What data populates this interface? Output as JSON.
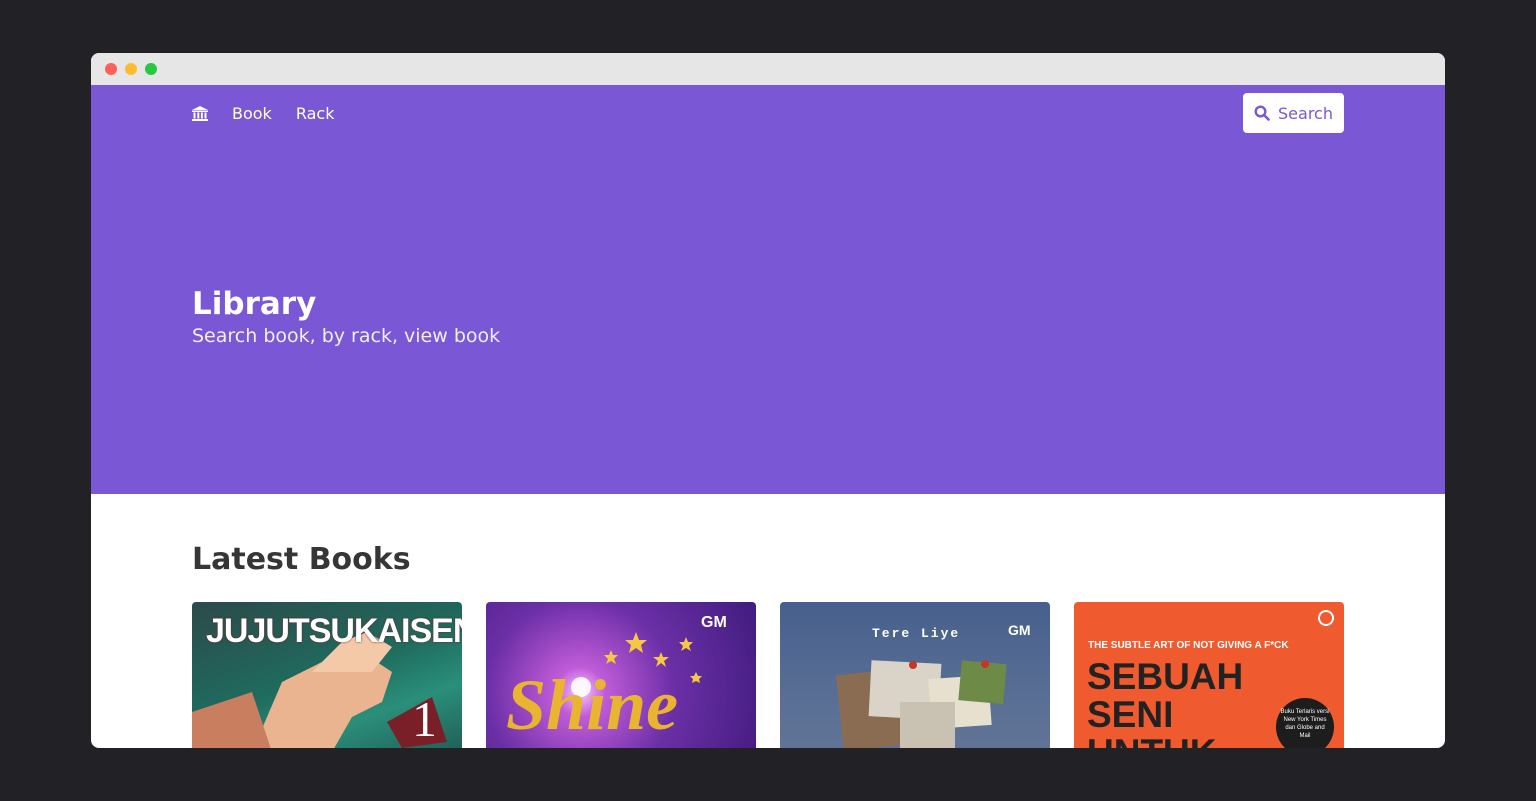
{
  "window": {
    "dots": [
      "#ff5f57",
      "#febc2e",
      "#28c840"
    ]
  },
  "nav": {
    "logo_icon": "bank-icon",
    "links": [
      "Book",
      "Rack"
    ],
    "search_label": "Search"
  },
  "hero": {
    "title": "Library",
    "subtitle": "Search book, by rack, view book",
    "background": "#7957d5"
  },
  "latest": {
    "title": "Latest Books",
    "books": [
      {
        "cover_text": "JUJUTSUKAISEN",
        "volume": "1"
      },
      {
        "cover_text": "Shine",
        "publisher": "GM"
      },
      {
        "cover_text": "Tere Liye",
        "publisher": "GM"
      },
      {
        "cover_text_top": "THE SUBTLE ART OF NOT GIVING A F*CK",
        "cover_text_main": "SEBUAH SENI UNTUK",
        "badge": "Buku Terlaris versi New York Times dan Globe and Mail"
      }
    ]
  }
}
